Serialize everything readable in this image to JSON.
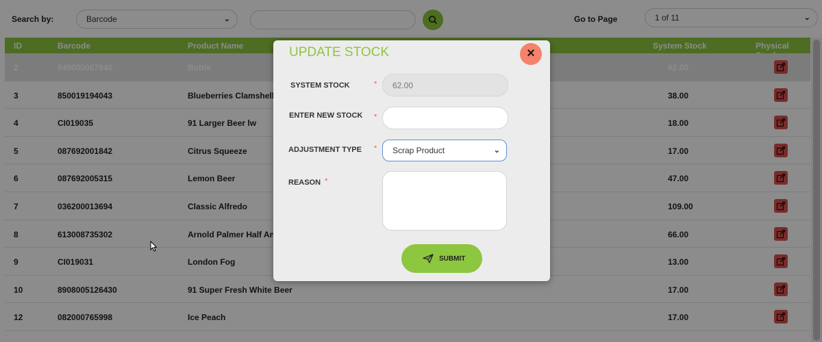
{
  "toolbar": {
    "search_by_label": "Search by:",
    "search_by_value": "Barcode",
    "search_query": "",
    "go_to_page_label": "Go to Page",
    "page_value": "1 of 11"
  },
  "table": {
    "headers": [
      "ID",
      "Barcode",
      "Product Name",
      "System Stock",
      "Physical Stock"
    ],
    "rows": [
      {
        "id": "2",
        "barcode": "049000007640",
        "name": "Bottle",
        "stock": "62.00"
      },
      {
        "id": "3",
        "barcode": "850019194043",
        "name": "Blueberries Clamshell",
        "stock": "38.00"
      },
      {
        "id": "4",
        "barcode": "CI019035",
        "name": "91 Larger Beer lw",
        "stock": "18.00"
      },
      {
        "id": "5",
        "barcode": "087692001842",
        "name": "Citrus Squeeze",
        "stock": "17.00"
      },
      {
        "id": "6",
        "barcode": "087692005315",
        "name": "Lemon Beer",
        "stock": "47.00"
      },
      {
        "id": "7",
        "barcode": "036200013694",
        "name": "Classic Alfredo",
        "stock": "109.00"
      },
      {
        "id": "8",
        "barcode": "613008735302",
        "name": "Arnold Palmer Half And",
        "stock": "66.00"
      },
      {
        "id": "9",
        "barcode": "CI019031",
        "name": "London Fog",
        "stock": "13.00"
      },
      {
        "id": "10",
        "barcode": "8908005126430",
        "name": "91 Super Fresh White Beer",
        "stock": "17.00"
      },
      {
        "id": "12",
        "barcode": "082000765998",
        "name": "Ice Peach",
        "stock": "17.00"
      }
    ]
  },
  "modal": {
    "title": "UPDATE STOCK",
    "close_label": "×",
    "system_stock_label": "SYSTEM STOCK",
    "system_stock_value": "62.00",
    "new_stock_label": "ENTER NEW STOCK",
    "new_stock_value": "",
    "adjustment_type_label": "ADJUSTMENT TYPE",
    "adjustment_type_value": "Scrap Product",
    "reason_label": "REASON",
    "reason_value": "",
    "required_mark": "*",
    "submit_label": "SUBMIT"
  },
  "colors": {
    "accent": "#8dc63f",
    "edit_button": "#d9534f",
    "close_button": "#f5826b"
  }
}
